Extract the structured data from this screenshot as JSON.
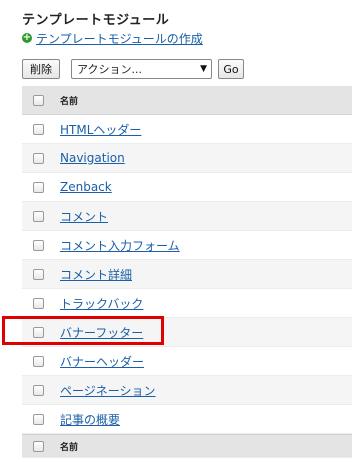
{
  "page": {
    "title": "テンプレートモジュール",
    "create_link": "テンプレートモジュールの作成"
  },
  "toolbar": {
    "delete_label": "削除",
    "action_selected": "アクション...",
    "go_label": "Go"
  },
  "table": {
    "header_label": "名前",
    "footer_label": "名前",
    "rows": [
      {
        "name": "HTMLヘッダー"
      },
      {
        "name": "Navigation"
      },
      {
        "name": "Zenback"
      },
      {
        "name": "コメント"
      },
      {
        "name": "コメント入力フォーム"
      },
      {
        "name": "コメント詳細"
      },
      {
        "name": "トラックバック"
      },
      {
        "name": "バナーフッター",
        "highlighted": true
      },
      {
        "name": "バナーヘッダー"
      },
      {
        "name": "ページネーション"
      },
      {
        "name": "記事の概要"
      }
    ]
  },
  "colors": {
    "link": "#1a5fa8",
    "highlight": "#e00000",
    "add_icon": "#2e9a2e",
    "header_bg": "#e4e4e4",
    "alt_row_bg": "#f5f5f5"
  },
  "icons": {
    "create": "plus-circle-icon",
    "select": "dropdown-arrow-icon"
  }
}
